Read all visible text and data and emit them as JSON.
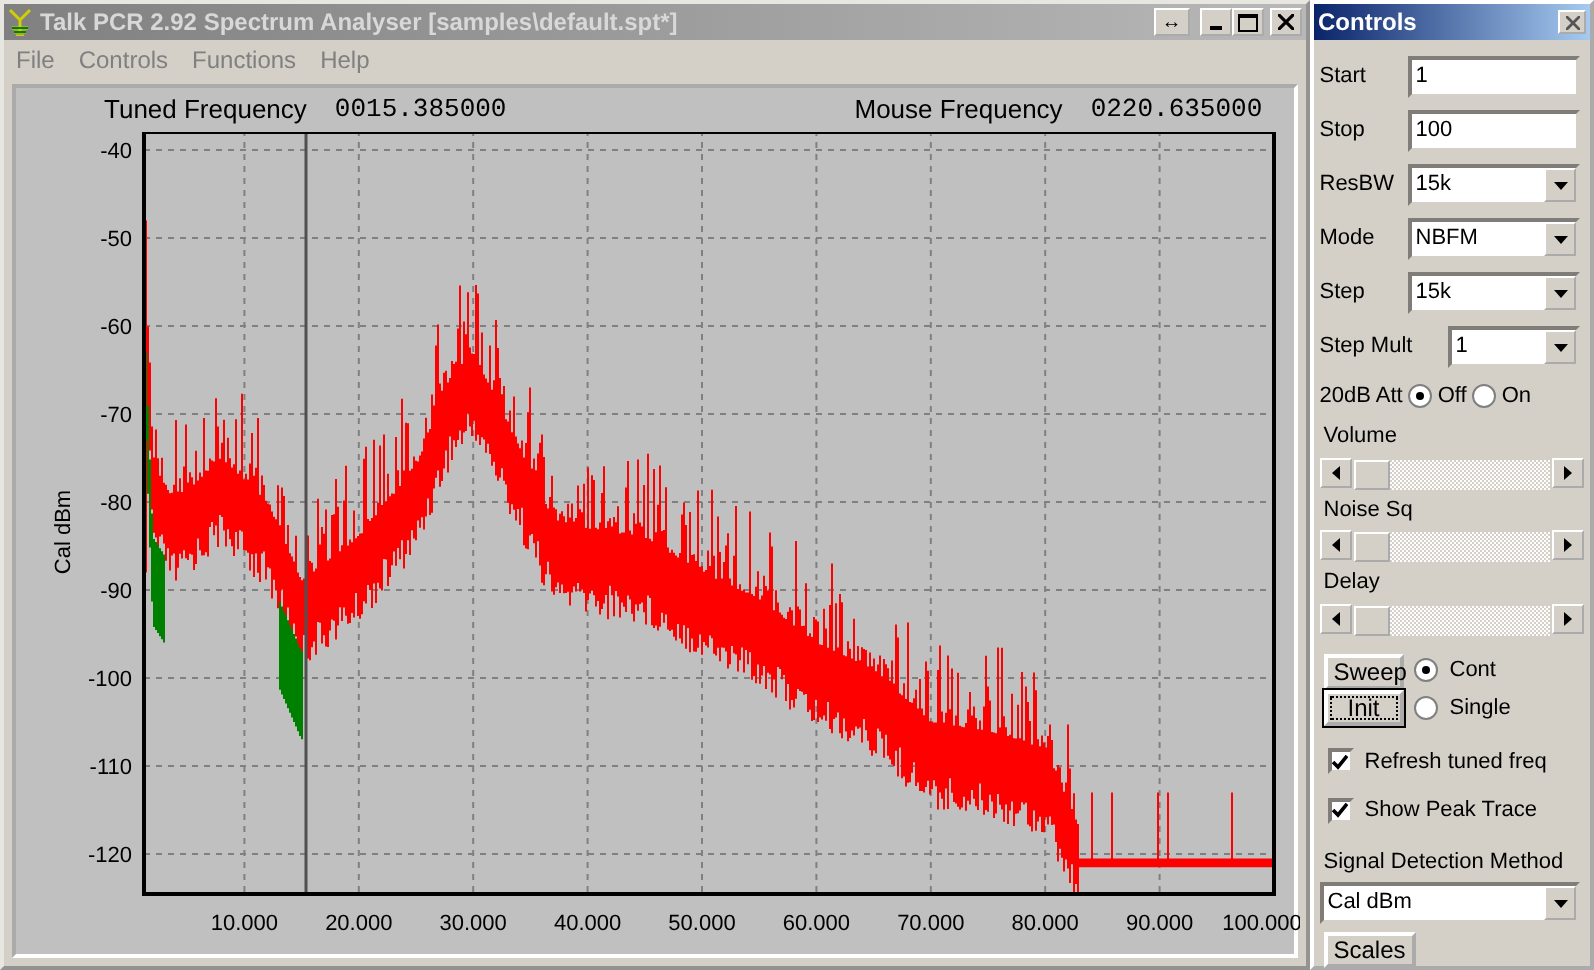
{
  "window": {
    "title": "Talk PCR 2.92 Spectrum Analyser [samples\\default.spt*]",
    "resize_glyph": "↔"
  },
  "menu": [
    "File",
    "Controls",
    "Functions",
    "Help"
  ],
  "readouts": [
    {
      "label": "Tuned Frequency",
      "value": "0015.385000"
    },
    {
      "label": "Mouse Frequency",
      "value": "0220.635000"
    }
  ],
  "plot": {
    "ylabel": "Cal dBm",
    "yticks": [
      "-40",
      "-50",
      "-60",
      "-70",
      "-80",
      "-90",
      "-100",
      "-110",
      "-120"
    ],
    "xticks": [
      "10.000",
      "20.000",
      "30.000",
      "40.000",
      "50.000",
      "60.000",
      "70.000",
      "80.000",
      "90.000",
      "100.000"
    ]
  },
  "controls": {
    "title": "Controls",
    "fields": [
      {
        "kind": "text",
        "label": "Start",
        "value": "1"
      },
      {
        "kind": "text",
        "label": "Stop",
        "value": "100"
      },
      {
        "kind": "select",
        "label": "ResBW",
        "value": "15k"
      },
      {
        "kind": "select",
        "label": "Mode",
        "value": "NBFM"
      },
      {
        "kind": "select",
        "label": "Step",
        "value": "15k"
      },
      {
        "kind": "select",
        "label": "Step Mult",
        "value": "1"
      }
    ],
    "attenuator": {
      "label": "20dB Att",
      "options": [
        {
          "label": "Off",
          "selected": true
        },
        {
          "label": "On",
          "selected": false
        }
      ]
    },
    "sliders": [
      {
        "label": "Volume",
        "level": 0.0
      },
      {
        "label": "Noise Sq",
        "level": 0.0
      },
      {
        "label": "Delay",
        "level": 0.0
      }
    ],
    "sweep_buttons": [
      "Sweep",
      "Init"
    ],
    "sweep_modes": [
      {
        "label": "Cont",
        "selected": true
      },
      {
        "label": "Single",
        "selected": false
      }
    ],
    "checkboxes": [
      {
        "label": "Refresh tuned freq",
        "checked": true
      },
      {
        "label": "Show Peak Trace",
        "checked": true
      }
    ],
    "detection": {
      "label": "Signal Detection Method",
      "value": "Cal dBm"
    },
    "scales_button": "Scales"
  }
}
